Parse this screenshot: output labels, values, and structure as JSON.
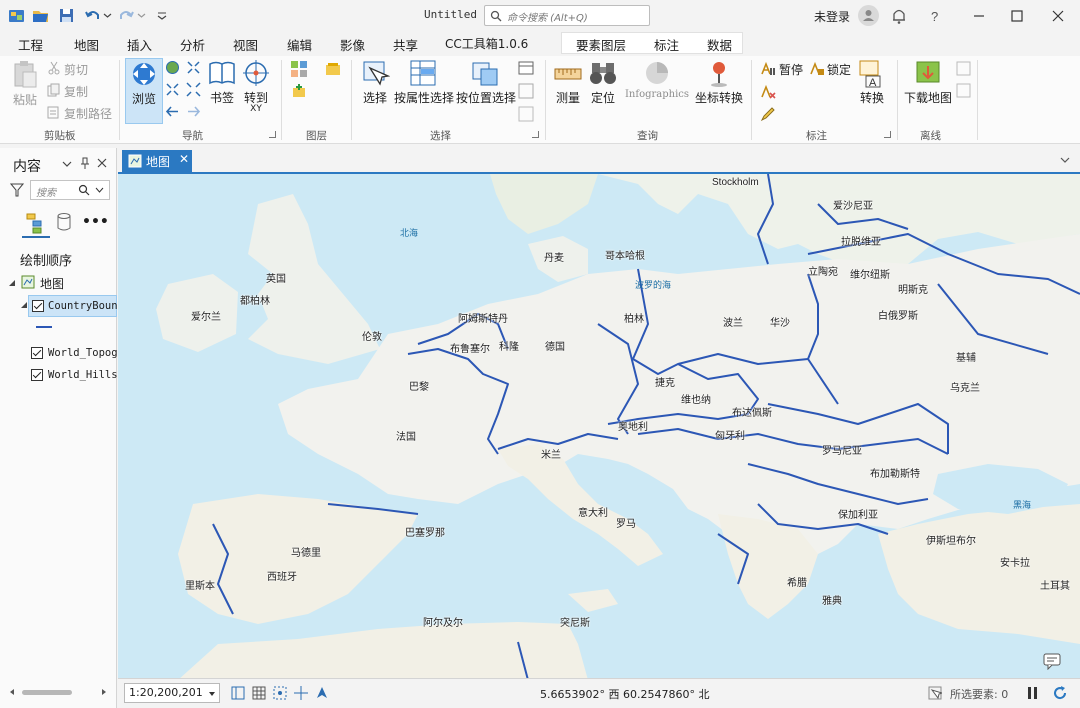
{
  "window": {
    "title": "Untitled",
    "search_placeholder": "命令搜索 (Alt+Q)",
    "login_label": "未登录"
  },
  "tabs": [
    "工程",
    "地图",
    "插入",
    "分析",
    "视图",
    "编辑",
    "影像",
    "共享",
    "CC工具箱1.0.6"
  ],
  "active_tab": "地图",
  "context_tabs": [
    "要素图层",
    "标注",
    "数据"
  ],
  "ribbon": {
    "clipboard": {
      "paste": "粘贴",
      "cut": "剪切",
      "copy": "复制",
      "copy_path": "复制路径",
      "group": "剪贴板"
    },
    "navigate": {
      "explore": "浏览",
      "bookmarks": "书签",
      "goto_xy": "转到",
      "goto_xy_sub": "XY",
      "group": "导航"
    },
    "layer": {
      "group": "图层"
    },
    "selection": {
      "select": "选择",
      "select_by_attr": "按属性选择",
      "select_by_loc": "按位置选择",
      "group": "选择"
    },
    "inquiry": {
      "measure": "测量",
      "locate": "定位",
      "infographics": "Infographics",
      "convert_coords": "坐标转换",
      "group": "查询"
    },
    "labeling": {
      "pause": "暂停",
      "lock": "锁定",
      "convert": "转换",
      "group": "标注"
    },
    "offline": {
      "download_map": "下载地图",
      "group": "离线"
    }
  },
  "contents_pane": {
    "title": "内容",
    "search_placeholder": "搜索",
    "draw_order": "绘制顺序",
    "map_node": "地图",
    "layers": [
      "CountryBounc",
      "World_Topogr",
      "World_Hillsh"
    ]
  },
  "map_view": {
    "tab_label": "地图",
    "labels": [
      {
        "text": "Stockholm",
        "kind": "en"
      },
      {
        "text": "爱沙尼亚",
        "kind": "place"
      },
      {
        "text": "北海",
        "kind": "sea"
      },
      {
        "text": "拉脱维亚",
        "kind": "place"
      },
      {
        "text": "丹麦",
        "kind": "place"
      },
      {
        "text": "哥本哈根",
        "kind": "place"
      },
      {
        "text": "立陶宛",
        "kind": "place"
      },
      {
        "text": "维尔纽斯",
        "kind": "place"
      },
      {
        "text": "英国",
        "kind": "place"
      },
      {
        "text": "波罗的海",
        "kind": "sea"
      },
      {
        "text": "明斯克",
        "kind": "place"
      },
      {
        "text": "都柏林",
        "kind": "place"
      },
      {
        "text": "白俄罗斯",
        "kind": "place"
      },
      {
        "text": "爱尔兰",
        "kind": "place"
      },
      {
        "text": "阿姆斯特丹",
        "kind": "place"
      },
      {
        "text": "柏林",
        "kind": "place"
      },
      {
        "text": "波兰",
        "kind": "place"
      },
      {
        "text": "华沙",
        "kind": "place"
      },
      {
        "text": "伦敦",
        "kind": "place"
      },
      {
        "text": "科隆",
        "kind": "place"
      },
      {
        "text": "德国",
        "kind": "place"
      },
      {
        "text": "布鲁塞尔",
        "kind": "place"
      },
      {
        "text": "基辅",
        "kind": "place"
      },
      {
        "text": "巴黎",
        "kind": "place"
      },
      {
        "text": "捷克",
        "kind": "place"
      },
      {
        "text": "乌克兰",
        "kind": "place"
      },
      {
        "text": "维也纳",
        "kind": "place"
      },
      {
        "text": "布达佩斯",
        "kind": "place"
      },
      {
        "text": "奥地利",
        "kind": "place"
      },
      {
        "text": "法国",
        "kind": "place"
      },
      {
        "text": "匈牙利",
        "kind": "place"
      },
      {
        "text": "罗马尼亚",
        "kind": "place"
      },
      {
        "text": "米兰",
        "kind": "place"
      },
      {
        "text": "布加勒斯特",
        "kind": "place"
      },
      {
        "text": "黑海",
        "kind": "sea"
      },
      {
        "text": "意大利",
        "kind": "place"
      },
      {
        "text": "巴塞罗那",
        "kind": "place"
      },
      {
        "text": "罗马",
        "kind": "place"
      },
      {
        "text": "保加利亚",
        "kind": "place"
      },
      {
        "text": "马德里",
        "kind": "place"
      },
      {
        "text": "伊斯坦布尔",
        "kind": "place"
      },
      {
        "text": "西班牙",
        "kind": "place"
      },
      {
        "text": "安卡拉",
        "kind": "place"
      },
      {
        "text": "里斯本",
        "kind": "place"
      },
      {
        "text": "希腊",
        "kind": "place"
      },
      {
        "text": "雅典",
        "kind": "place"
      },
      {
        "text": "土耳其",
        "kind": "place"
      },
      {
        "text": "阿尔及尔",
        "kind": "place"
      },
      {
        "text": "突尼斯",
        "kind": "place"
      }
    ]
  },
  "status_bar": {
    "scale": "1:20,200,201",
    "coordinates": "5.6653902° 西  60.2547860° 北",
    "selected_features": "所选要素: 0"
  },
  "colors": {
    "accent": "#2b79c2",
    "border_line": "#2c57b5",
    "sea": "#d3ecf7",
    "land": "#f2f2ee"
  }
}
